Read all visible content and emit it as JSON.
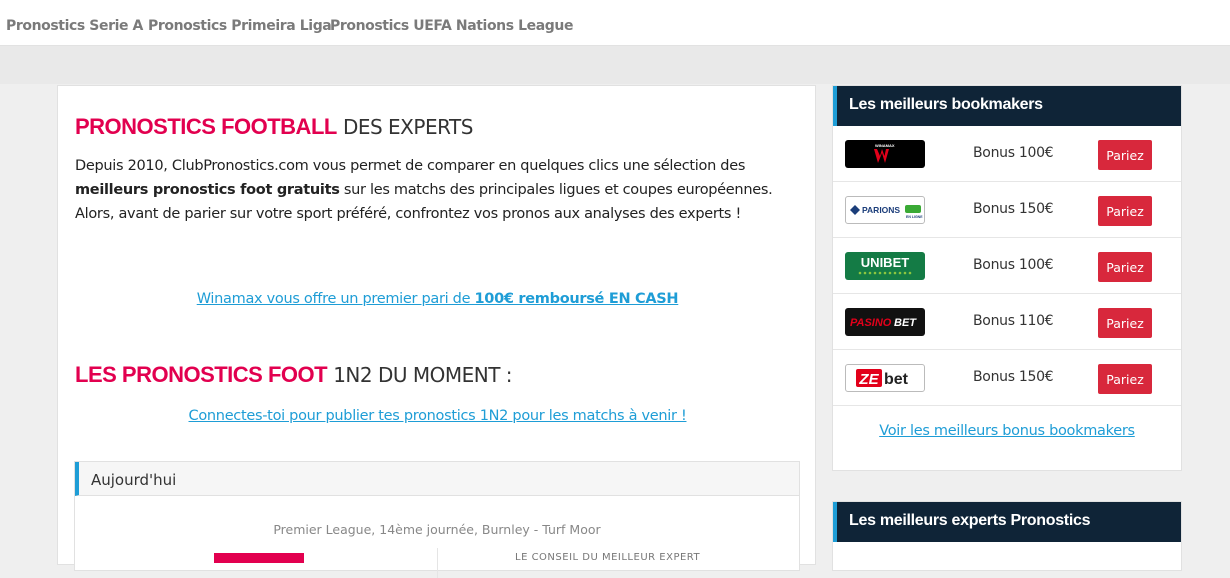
{
  "nav": {
    "items": [
      "Pronostics Serie A",
      "Pronostics Primeira Liga",
      "Pronostics UEFA Nations League"
    ]
  },
  "main": {
    "title_strong": "PRONOSTICS FOOTBALL",
    "title_rest": "DES EXPERTS",
    "intro": {
      "part1": "Depuis 2010, ClubPronostics.com vous permet de comparer en quelques clics une sélection des ",
      "bold1": "meilleurs pronostics foot gratuits",
      "part2": " sur les matchs des principales ligues et coupes européennes. Alors, avant de parier sur votre sport préféré, confrontez vos pronos aux analyses des experts !"
    },
    "promo_text": "Winamax vous offre un premier pari de ",
    "promo_bold": "100€ remboursé EN CASH",
    "section_strong": "LES PRONOSTICS FOOT",
    "section_rest": "1N2 DU MOMENT :",
    "connect_link": "Connectes-toi pour publier tes pronostics 1N2 pour les matchs à venir !",
    "today_label": "Aujourd'hui",
    "match_info": "Premier League, 14ème journée,  Burnley - Turf Moor",
    "conseil_text": "LE CONSEIL DU MEILLEUR EXPERT"
  },
  "sidebar": {
    "bookmakers_title": "Les meilleurs bookmakers",
    "bookmakers": [
      {
        "name": "WINAMAX",
        "bonus": "Bonus 100€",
        "button": "Pariez",
        "icon": "winamax-logo",
        "color": "#c8102e"
      },
      {
        "name": "PARIONS SPORT",
        "bonus": "Bonus 150€",
        "button": "Pariez",
        "icon": "parions-sport-logo",
        "color": "#1b3d7a"
      },
      {
        "name": "UNIBET",
        "bonus": "Bonus 100€",
        "button": "Pariez",
        "icon": "unibet-logo",
        "color": "#147b45"
      },
      {
        "name": "PASINOBET",
        "bonus": "Bonus 110€",
        "button": "Pariez",
        "icon": "pasinobet-logo",
        "color": "#111111"
      },
      {
        "name": "ZEbet",
        "bonus": "Bonus 150€",
        "button": "Pariez",
        "icon": "zebet-logo",
        "color": "#e2001a"
      }
    ],
    "more_link": "Voir les meilleurs bonus bookmakers",
    "experts_title": "Les meilleurs experts Pronostics"
  }
}
